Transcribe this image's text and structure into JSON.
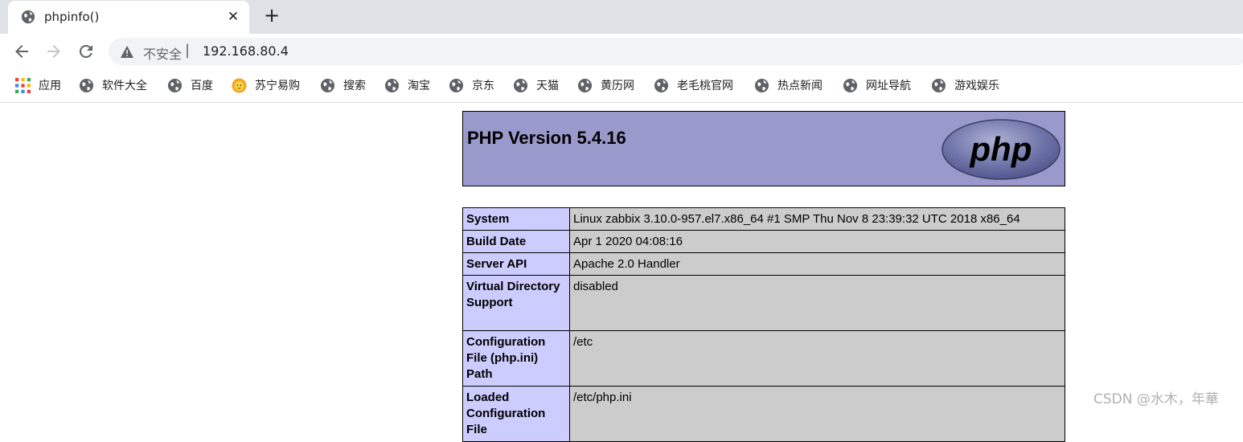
{
  "tab": {
    "title": "phpinfo()",
    "favicon_icon": "globe-icon",
    "close_icon": "close-icon"
  },
  "new_tab_icon": "plus-icon",
  "toolbar": {
    "back_icon": "back-arrow-icon",
    "forward_icon": "forward-arrow-icon",
    "reload_icon": "reload-icon",
    "security_label": "不安全",
    "url": "192.168.80.4"
  },
  "bookmarks": [
    {
      "label": "应用",
      "icon": "apps-grid-icon"
    },
    {
      "label": "软件大全",
      "icon": "globe-icon"
    },
    {
      "label": "百度",
      "icon": "globe-icon"
    },
    {
      "label": "苏宁易购",
      "icon": "suning-lion-icon"
    },
    {
      "label": "搜索",
      "icon": "globe-icon"
    },
    {
      "label": "淘宝",
      "icon": "globe-icon"
    },
    {
      "label": "京东",
      "icon": "globe-icon"
    },
    {
      "label": "天猫",
      "icon": "globe-icon"
    },
    {
      "label": "黄历网",
      "icon": "globe-icon"
    },
    {
      "label": "老毛桃官网",
      "icon": "globe-icon"
    },
    {
      "label": "热点新闻",
      "icon": "globe-icon"
    },
    {
      "label": "网址导航",
      "icon": "globe-icon"
    },
    {
      "label": "游戏娱乐",
      "icon": "globe-icon"
    }
  ],
  "php": {
    "title": "PHP Version 5.4.16",
    "logo_text": "php",
    "header_color": "#9999cc",
    "key_color": "#ccccff",
    "value_color": "#cccccc",
    "rows": [
      {
        "key": "System",
        "value": "Linux zabbix 3.10.0-957.el7.x86_64 #1 SMP Thu Nov 8 23:39:32 UTC 2018 x86_64"
      },
      {
        "key": "Build Date",
        "value": "Apr 1 2020 04:08:16"
      },
      {
        "key": "Server API",
        "value": "Apache 2.0 Handler"
      },
      {
        "key": "Virtual Directory Support",
        "value": "disabled"
      },
      {
        "key": "Configuration File (php.ini) Path",
        "value": "/etc"
      },
      {
        "key": "Loaded Configuration File",
        "value": "/etc/php.ini"
      }
    ]
  },
  "watermark": "CSDN @水木，年華"
}
